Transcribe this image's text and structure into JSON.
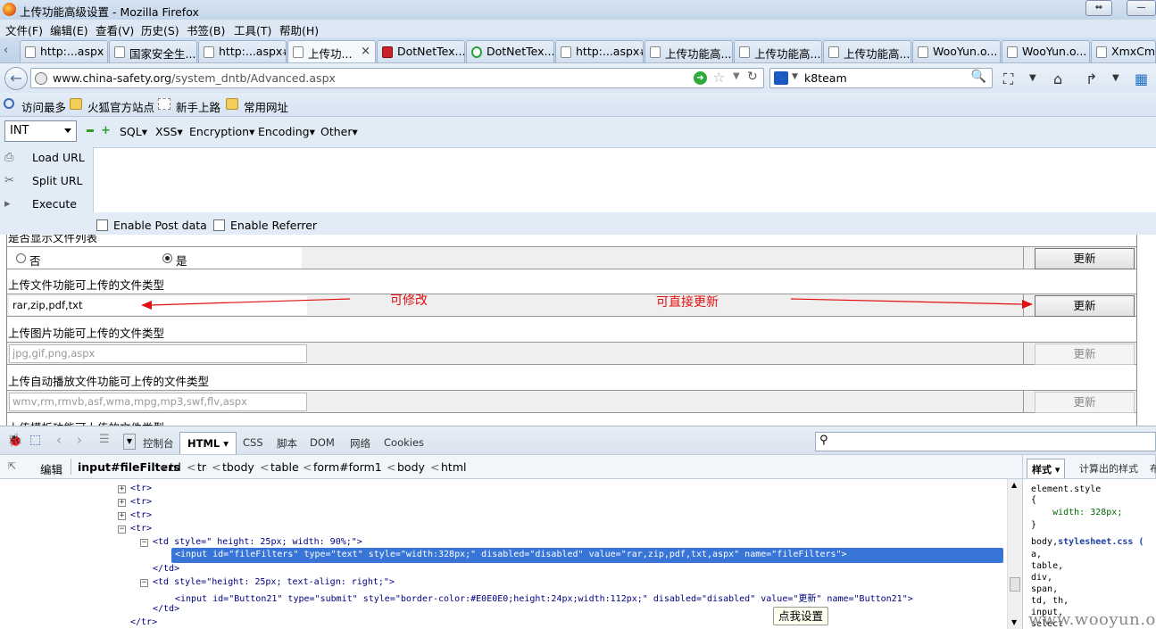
{
  "window": {
    "title": "上传功能高级设置 - Mozilla Firefox"
  },
  "menu": [
    "文件(F)",
    "编辑(E)",
    "查看(V)",
    "历史(S)",
    "书签(B)",
    "工具(T)",
    "帮助(H)"
  ],
  "tabs": [
    {
      "label": "http:...aspx",
      "icon": "page-icon"
    },
    {
      "label": "国家安全生...",
      "icon": "page-icon"
    },
    {
      "label": "http:...aspx#",
      "icon": "page-icon"
    },
    {
      "label": "上传功...",
      "icon": "page-icon",
      "active": true,
      "close": "×"
    },
    {
      "label": "DotNetTex...",
      "icon": "shield-icon"
    },
    {
      "label": "DotNetTex...",
      "icon": "loading-icon"
    },
    {
      "label": "http:...aspx#",
      "icon": "page-icon"
    },
    {
      "label": "上传功能高...",
      "icon": "page-icon"
    },
    {
      "label": "上传功能高...",
      "icon": "page-icon"
    },
    {
      "label": "上传功能高...",
      "icon": "page-icon"
    },
    {
      "label": "WooYun.o...",
      "icon": "page-icon"
    },
    {
      "label": "WooYun.o...",
      "icon": "page-icon"
    },
    {
      "label": "XmxCms",
      "icon": "page-icon"
    }
  ],
  "nav": {
    "url_domain": "www.china-safety.org",
    "url_path": "/system_dntb/Advanced.aspx",
    "search_value": "k8team"
  },
  "bookmarks": [
    "访问最多",
    "火狐官方站点",
    "新手上路",
    "常用网址"
  ],
  "hackbar": {
    "type_select": "INT",
    "menus": [
      "SQL",
      "XSS",
      "Encryption",
      "Encoding",
      "Other"
    ],
    "load_url": "Load URL",
    "split_url": "Split URL",
    "execute": "Execute",
    "enable_post": "Enable Post data",
    "enable_referrer": "Enable Referrer"
  },
  "page": {
    "truncated_top_label": "是否显示文件列表",
    "radio_no": "否",
    "radio_yes": "是",
    "update_label": "更新",
    "file_types_label": "上传文件功能可上传的文件类型",
    "file_types_value": "rar,zip,pdf,txt",
    "image_types_label": "上传图片功能可上传的文件类型",
    "image_types_value": "jpg,gif,png,aspx",
    "media_types_label": "上传自动播放文件功能可上传的文件类型",
    "media_types_value": "wmv,rm,rmvb,asf,wma,mpg,mp3,swf,flv,aspx",
    "truncated_bottom_label": "上传模板功能可上传的文件类型",
    "annotation_editable": "可修改",
    "annotation_update": "可直接更新"
  },
  "firebug": {
    "tabs": [
      "控制台",
      "HTML",
      "CSS",
      "脚本",
      "DOM",
      "网络",
      "Cookies"
    ],
    "edit": "编辑",
    "breadcrumb": [
      "input#fileFilters",
      "td",
      "tr",
      "tbody",
      "table",
      "form#form1",
      "body",
      "html"
    ],
    "html_lines": {
      "tr": "<tr>",
      "tr_close": "</tr>",
      "td_close": "</td>",
      "td1_open": "<td style=\" height: 25px; width: 90%;\">",
      "input1": "<input id=\"fileFilters\" type=\"text\" style=\"width:328px;\" disabled=\"disabled\" value=\"rar,zip,pdf,txt,aspx\" name=\"fileFilters\">",
      "td2_open": "<td style=\"height: 25px; text-align: right;\">",
      "input2": "<input id=\"Button21\" type=\"submit\" style=\"border-color:#E0E0E0;height:24px;width:112px;\" disabled=\"disabled\" value=\"更新\" name=\"Button21\">"
    },
    "side_tabs": [
      "样式",
      "计算出的样式",
      "布"
    ],
    "side_lines": [
      "element.style",
      "{",
      "    width: 328px;",
      "}",
      "body,stylesheet.css (",
      "a,",
      "table,",
      "div,",
      "span,",
      "td, th,",
      "input,",
      "select"
    ],
    "tooltip": "点我设置"
  },
  "watermark": "www.wooyun.org",
  "colors": {
    "annotation": "#e01010",
    "selection": "#3875d7"
  }
}
